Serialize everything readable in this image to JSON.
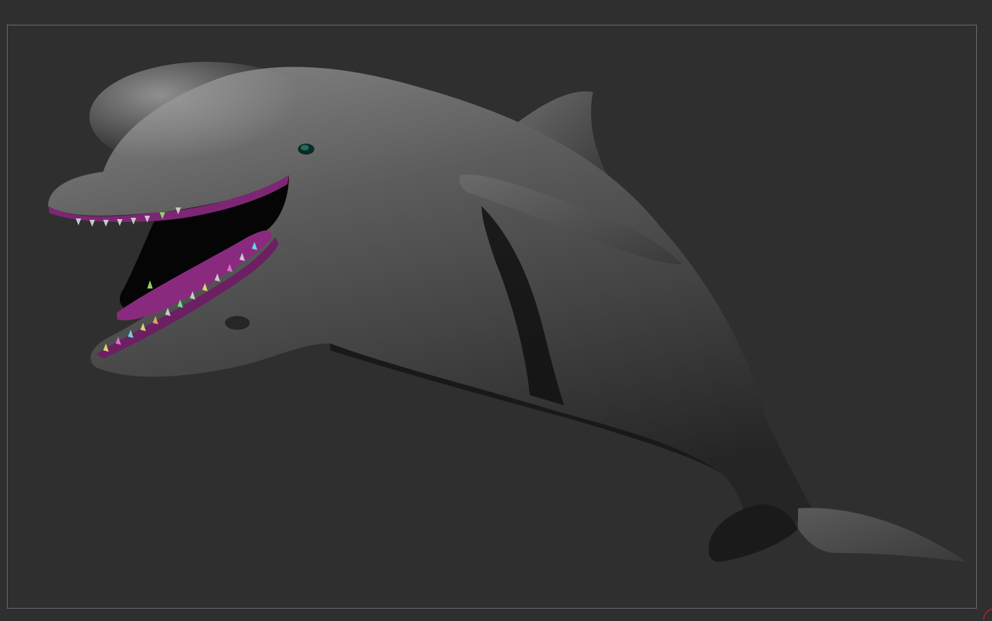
{
  "viewport": {
    "background_color": "#2f2f2f",
    "frame_color": "#6e6e6e"
  },
  "model": {
    "subject": "dolphin",
    "colors": {
      "skin": "#5c5c5c",
      "mouth": "#8a2a7e",
      "eye": "#1f6b5c"
    }
  },
  "corner_marker": {
    "icon": "red-arc-icon",
    "color": "#b3262a"
  }
}
